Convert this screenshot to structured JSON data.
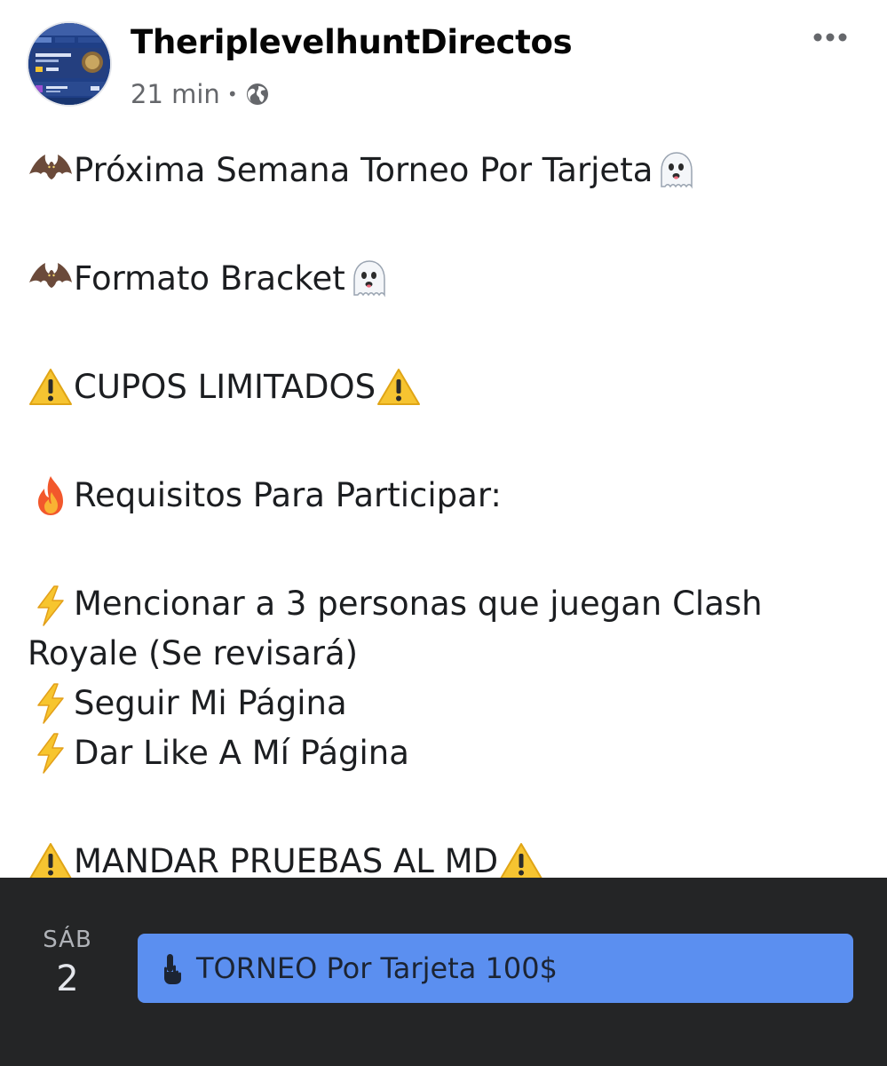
{
  "post": {
    "author": "TheriplevelhuntDirectos",
    "time": "21 min",
    "separator": "•",
    "privacy_icon": "globe-icon",
    "more_icon": "more-horizontal-icon"
  },
  "body": {
    "line1": "Próxima Semana Torneo Por Tarjeta",
    "line2": "Formato Bracket",
    "line3": "CUPOS LIMITADOS",
    "line4": "Requisitos Para Participar:",
    "line5": "Mencionar a 3 personas que juegan Clash Royale (Se revisará)",
    "line6": "Seguir Mi Página",
    "line7": "Dar Like A Mí Página",
    "line8": "MANDAR PRUEBAS AL MD"
  },
  "event": {
    "day_name": "SÁB",
    "day_number": "2",
    "title": "TORNEO Por Tarjeta 100$",
    "chip_color": "#5b8ff0",
    "icon": "pointing-hand-icon"
  }
}
